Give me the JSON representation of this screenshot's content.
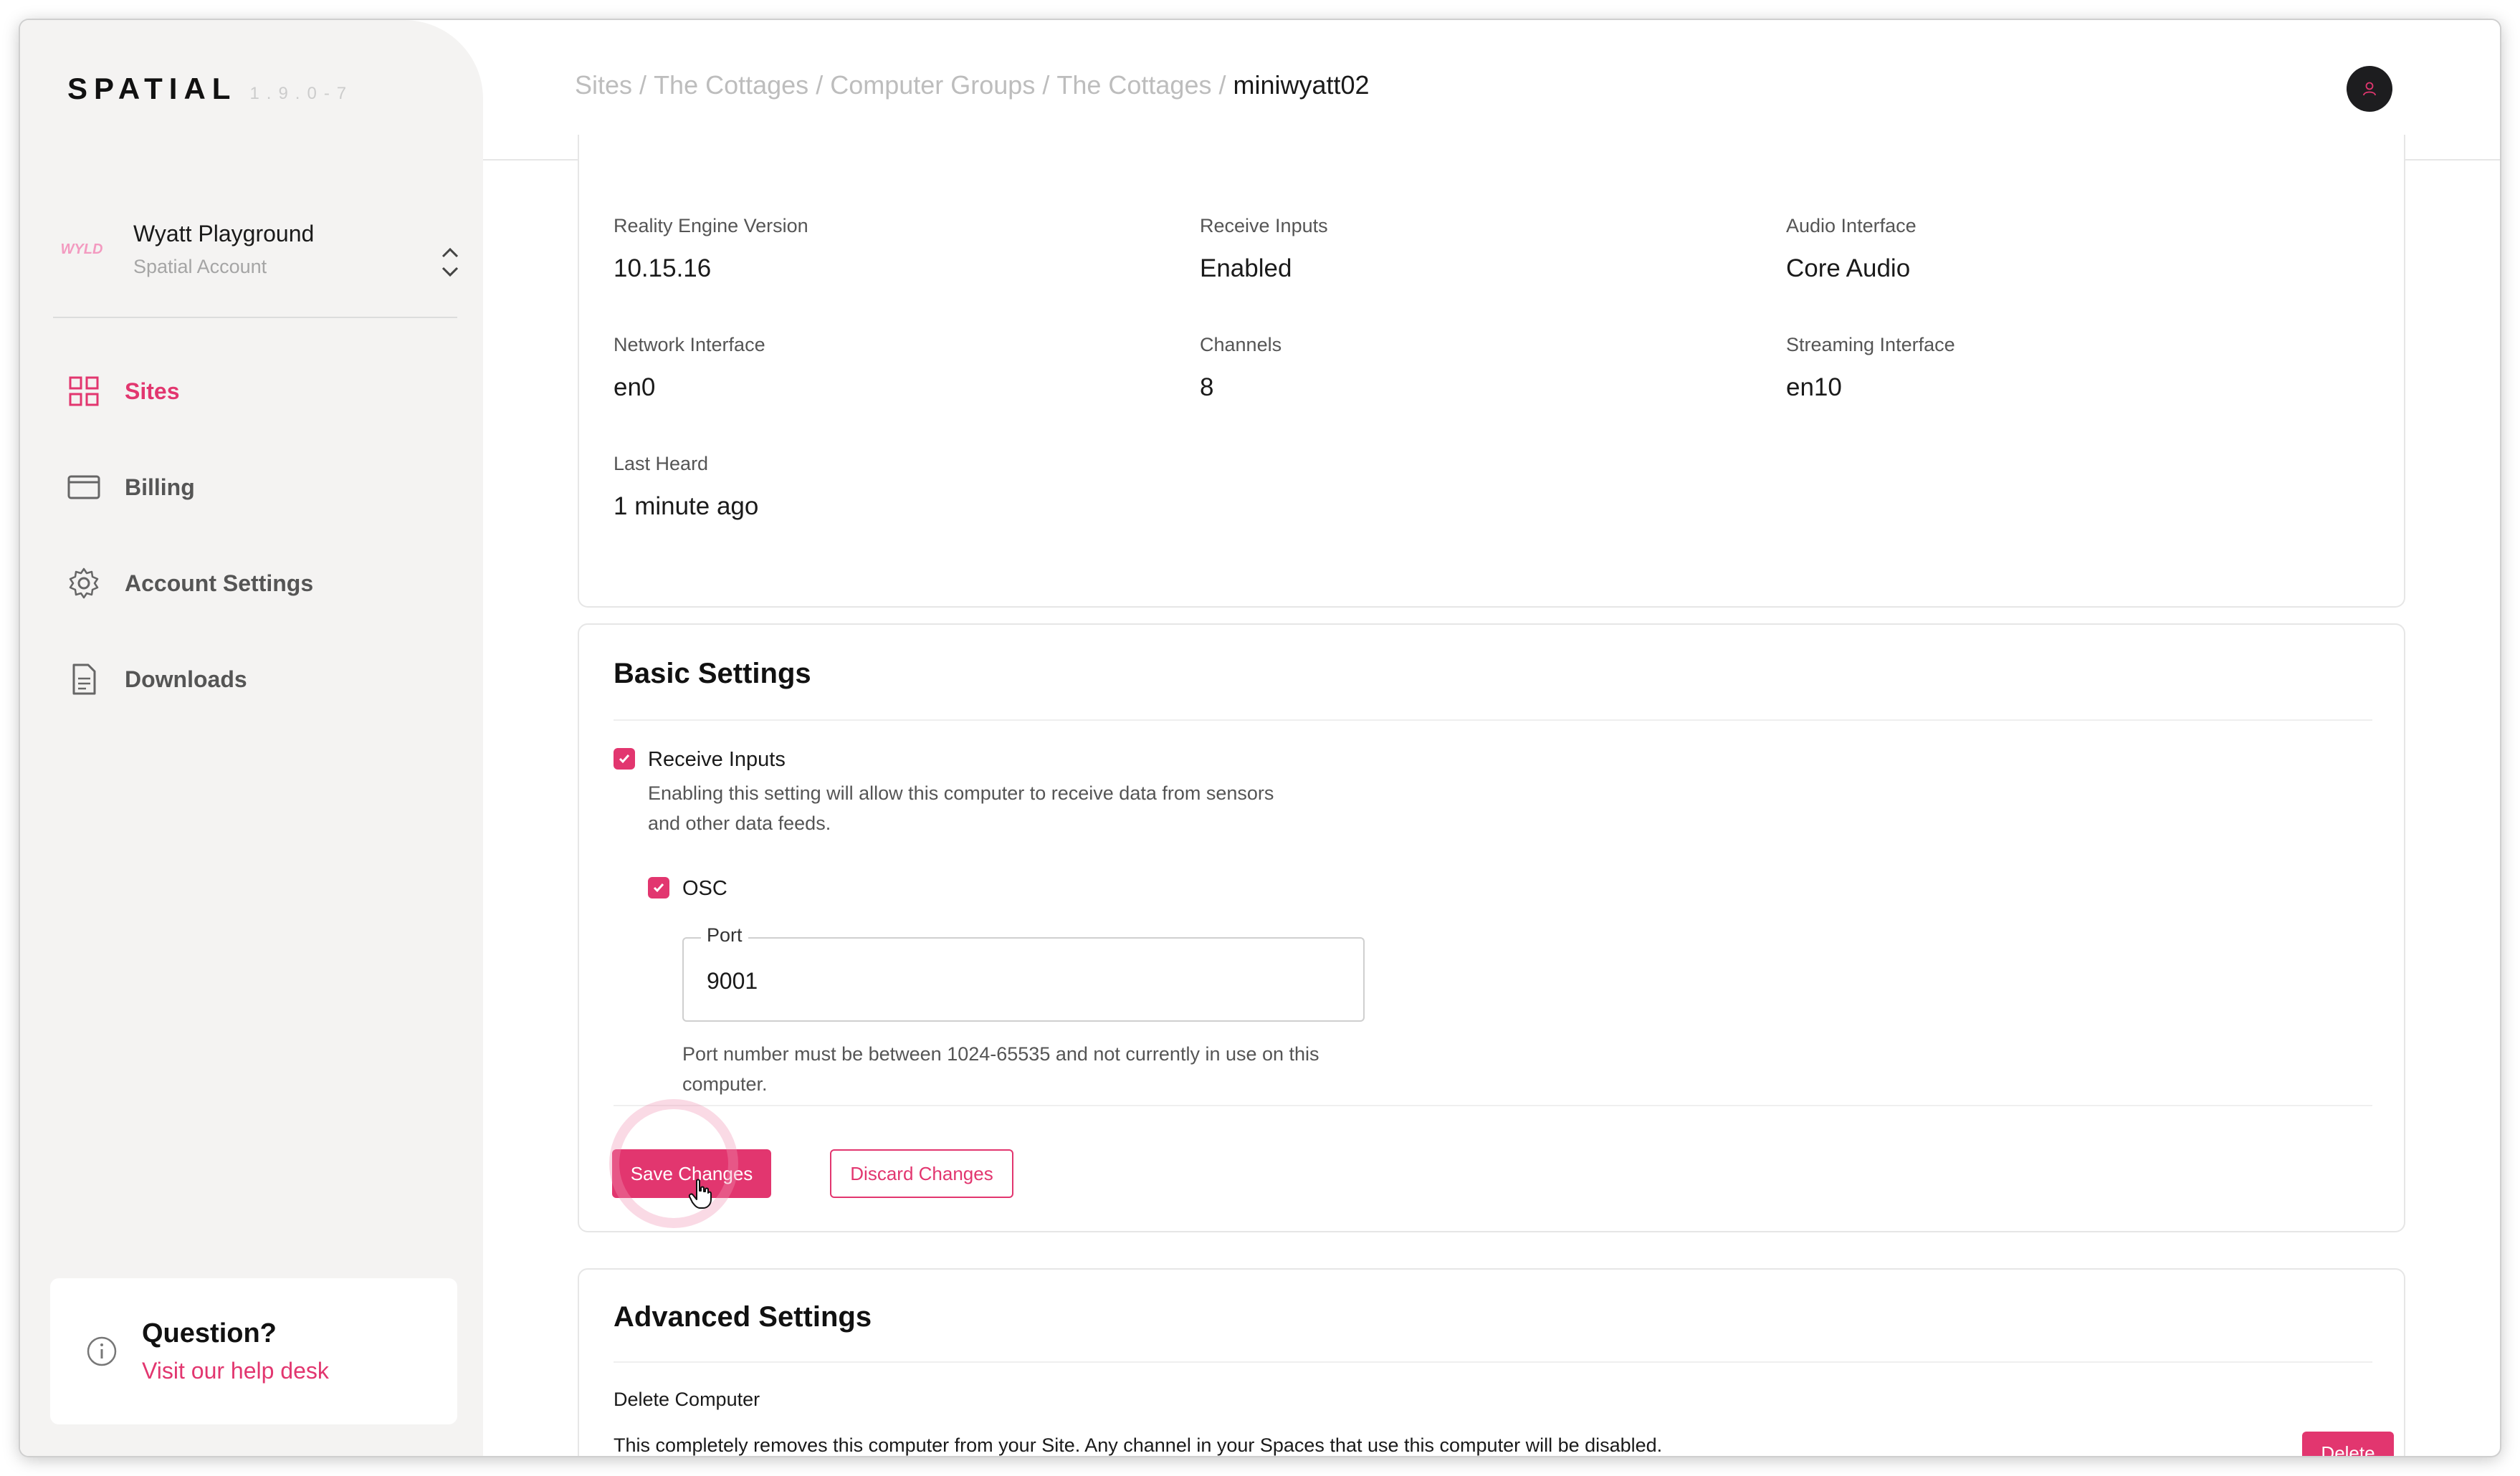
{
  "app": {
    "logo": "SPATIAL",
    "version": "1.9.0-7"
  },
  "account": {
    "logo_text": "WYLD",
    "name": "Wyatt Playground",
    "type": "Spatial Account"
  },
  "sidebar": {
    "items": [
      {
        "label": "Sites",
        "icon": "grid-icon",
        "active": true
      },
      {
        "label": "Billing",
        "icon": "credit-card-icon",
        "active": false
      },
      {
        "label": "Account Settings",
        "icon": "gear-icon",
        "active": false
      },
      {
        "label": "Downloads",
        "icon": "document-icon",
        "active": false
      }
    ],
    "help": {
      "title": "Question?",
      "link": "Visit our help desk"
    }
  },
  "breadcrumb": {
    "items": [
      "Sites",
      "The Cottages",
      "Computer Groups",
      "The Cottages"
    ],
    "separator": "/",
    "current": "miniwyatt02"
  },
  "info": {
    "reality_engine_version": {
      "label": "Reality Engine Version",
      "value": "10.15.16"
    },
    "receive_inputs": {
      "label": "Receive Inputs",
      "value": "Enabled"
    },
    "audio_interface": {
      "label": "Audio Interface",
      "value": "Core Audio"
    },
    "network_interface": {
      "label": "Network Interface",
      "value": "en0"
    },
    "channels": {
      "label": "Channels",
      "value": "8"
    },
    "streaming_interface": {
      "label": "Streaming Interface",
      "value": "en10"
    },
    "last_heard": {
      "label": "Last Heard",
      "value": "1 minute ago"
    }
  },
  "basic_settings": {
    "title": "Basic Settings",
    "receive_inputs": {
      "label": "Receive Inputs",
      "checked": true,
      "description_line1": "Enabling this setting will allow this computer to receive data from sensors",
      "description_line2": "and other data feeds."
    },
    "osc": {
      "label": "OSC",
      "checked": true
    },
    "port": {
      "legend": "Port",
      "value": "9001",
      "help_line1": "Port number must be between 1024-65535 and not currently in use on this",
      "help_line2": "computer."
    },
    "save_label": "Save Changes",
    "discard_label": "Discard Changes"
  },
  "advanced_settings": {
    "title": "Advanced Settings",
    "delete_heading": "Delete Computer",
    "delete_description": "This completely removes this computer from your Site. Any channel in your Spaces that use this computer will be disabled.",
    "delete_label": "Delete"
  },
  "colors": {
    "accent": "#e2366f",
    "sidebar_bg": "#f4f3f2"
  }
}
